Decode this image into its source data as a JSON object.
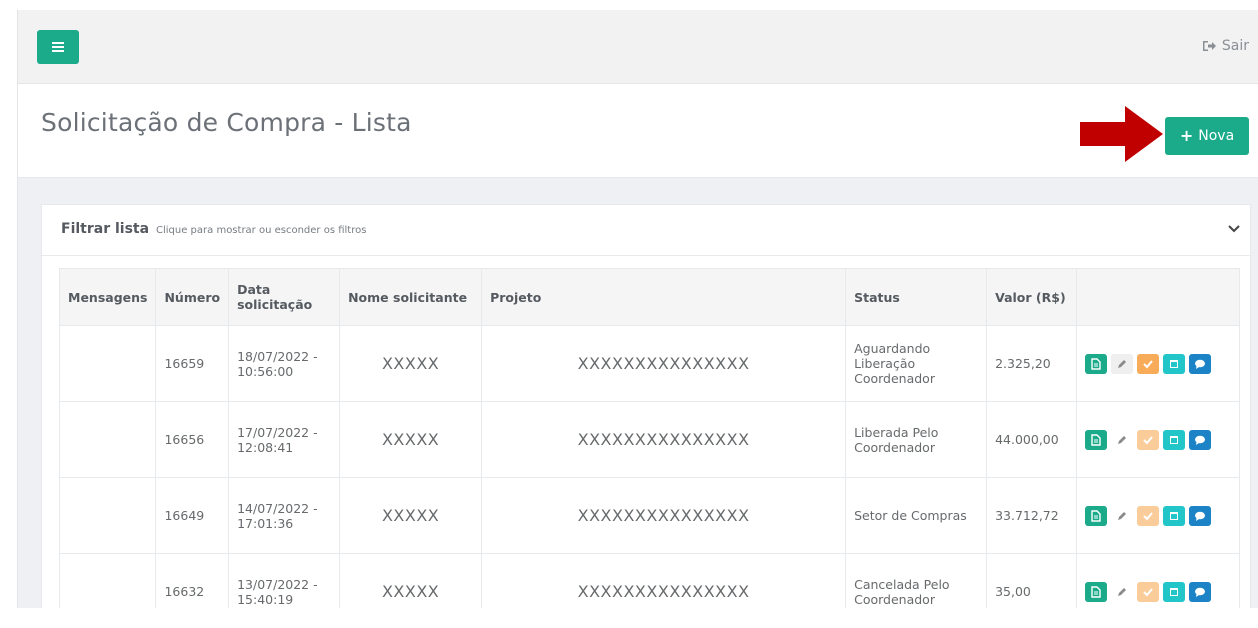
{
  "header": {
    "sair_label": "Sair"
  },
  "page": {
    "title": "Solicitação de Compra - Lista",
    "nova_label": "Nova"
  },
  "filter": {
    "title": "Filtrar lista",
    "subtitle": "Clique para mostrar ou esconder os filtros"
  },
  "table": {
    "columns": {
      "mensagens": "Mensagens",
      "numero": "Número",
      "data": "Data solicitação",
      "nome": "Nome solicitante",
      "projeto": "Projeto",
      "status": "Status",
      "valor": "Valor (R$)"
    },
    "rows": [
      {
        "numero": "16659",
        "data": "18/07/2022 - 10:56:00",
        "nome": "XXXXX",
        "projeto": "XXXXXXXXXXXXXXX",
        "status": "Aguardando Liberação Coordenador",
        "valor": "2.325,20"
      },
      {
        "numero": "16656",
        "data": "17/07/2022 - 12:08:41",
        "nome": "XXXXX",
        "projeto": "XXXXXXXXXXXXXXX",
        "status": "Liberada Pelo Coordenador",
        "valor": "44.000,00"
      },
      {
        "numero": "16649",
        "data": "14/07/2022 - 17:01:36",
        "nome": "XXXXX",
        "projeto": "XXXXXXXXXXXXXXX",
        "status": "Setor de Compras",
        "valor": "33.712,72"
      },
      {
        "numero": "16632",
        "data": "13/07/2022 - 15:40:19",
        "nome": "XXXXX",
        "projeto": "XXXXXXXXXXXXXXX",
        "status": "Cancelada Pelo Coordenador",
        "valor": "35,00"
      }
    ]
  },
  "colors": {
    "primary": "#1bab8a",
    "warning": "#f8ac59",
    "info": "#23c6c8",
    "success_blue": "#1c84c6",
    "arrow": "#c00000"
  },
  "icons": [
    "menu-icon",
    "sign-out-icon",
    "plus-icon",
    "chevron-down-icon",
    "file-icon",
    "pencil-icon",
    "check-icon",
    "calendar-icon",
    "comment-icon"
  ]
}
